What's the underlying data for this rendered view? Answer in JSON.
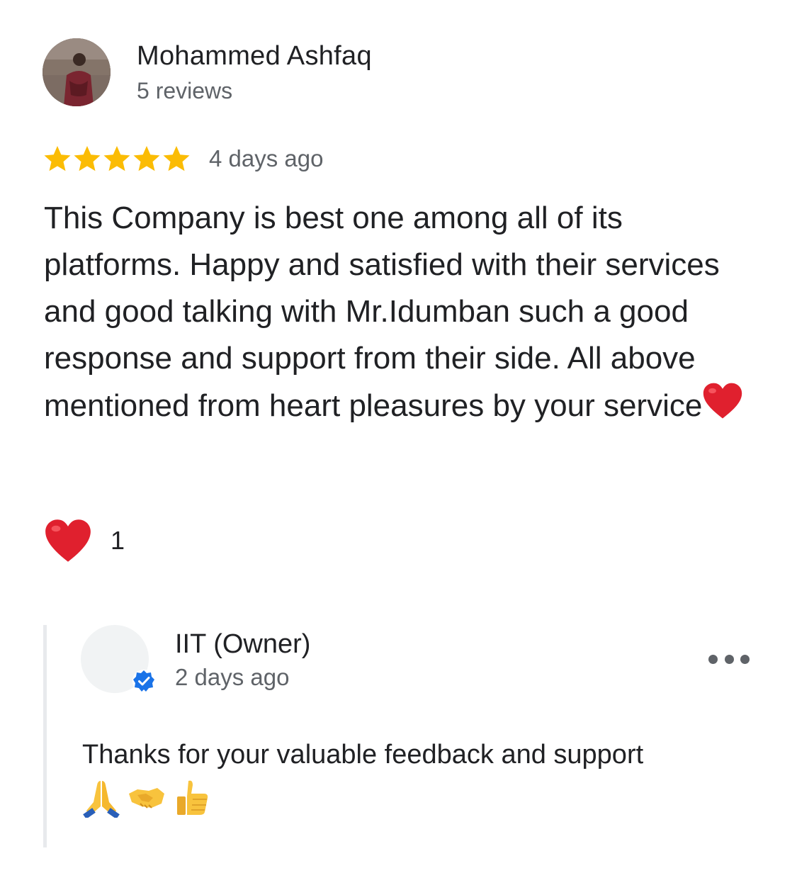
{
  "review": {
    "reviewer_name": "Mohammed Ashfaq",
    "reviewer_review_count": "5 reviews",
    "rating": 5,
    "rating_max": 5,
    "date": "4 days ago",
    "text": "This Company is best one among all of its platforms. Happy and satisfied with their services and good talking with Mr.Idumban such a good response and support from their side. All above mentioned from heart pleasures by your service",
    "text_trailing_icon": "red-heart-emoji",
    "reaction": {
      "icon": "red-heart-emoji",
      "count": "1"
    }
  },
  "owner_reply": {
    "name": "IIT (Owner)",
    "date": "2 days ago",
    "verified_icon": "verified-check-icon",
    "more_icon": "more-horizontal-icon",
    "text": "Thanks for your valuable feedback and support",
    "emojis": [
      "folded-hands-emoji",
      "handshake-emoji",
      "thumbs-up-emoji"
    ]
  },
  "colors": {
    "star": "#FBBC04",
    "primary_text": "#202124",
    "secondary_text": "#5f6368",
    "verified_badge": "#1A73E8",
    "heart": "#E0202E",
    "reply_bar": "#e8eaed"
  }
}
